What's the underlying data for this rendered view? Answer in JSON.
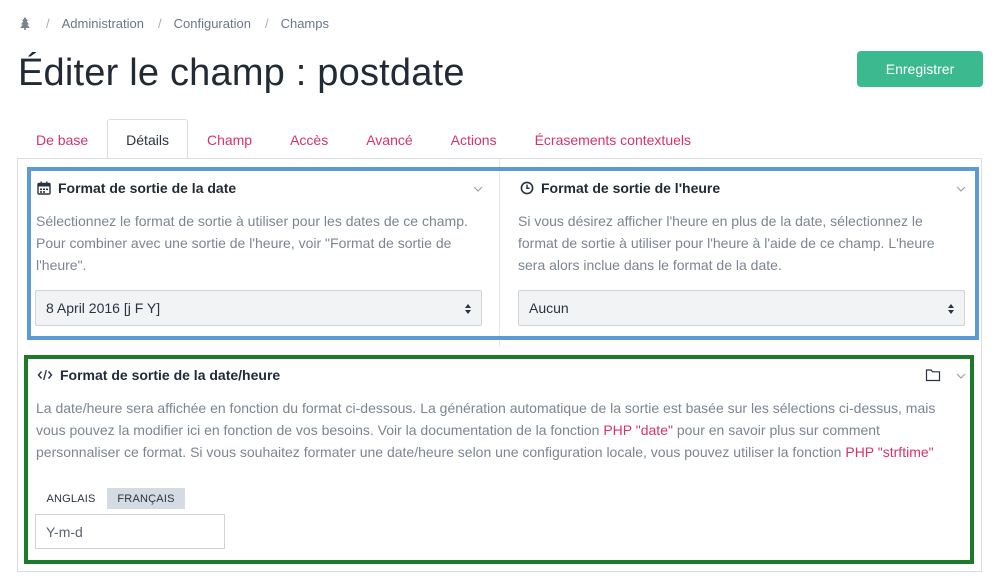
{
  "breadcrumb": {
    "home_icon": "tree-icon",
    "items": [
      "Administration",
      "Configuration",
      "Champs"
    ],
    "separator": "/"
  },
  "page": {
    "title": "Éditer le champ : postdate"
  },
  "toolbar": {
    "save_label": "Enregistrer",
    "save_color": "#3bb98f"
  },
  "tabs": [
    {
      "label": "De base",
      "active": false
    },
    {
      "label": "Détails",
      "active": true
    },
    {
      "label": "Champ",
      "active": false
    },
    {
      "label": "Accès",
      "active": false
    },
    {
      "label": "Avancé",
      "active": false
    },
    {
      "label": "Actions",
      "active": false
    },
    {
      "label": "Écrasements contextuels",
      "active": false
    }
  ],
  "date_format": {
    "icon": "calendar-icon",
    "title": "Format de sortie de la date",
    "help": "Sélectionnez le format de sortie à utiliser pour les dates de ce champ. Pour combiner avec une sortie de l'heure, voir \"Format de sortie de l'heure\".",
    "selected": "8 April 2016 [j F Y]"
  },
  "time_format": {
    "icon": "clock-icon",
    "title": "Format de sortie de l'heure",
    "help": "Si vous désirez afficher l'heure en plus de la date, sélectionnez le format de sortie à utiliser pour l'heure à l'aide de ce champ. L'heure sera alors inclue dans le format de la date.",
    "selected": "Aucun"
  },
  "datetime_format": {
    "icon": "code-icon",
    "title": "Format de sortie de la date/heure",
    "help_part1": "La date/heure sera affichée en fonction du format ci-dessous. La génération automatique de la sortie est basée sur les sélections ci-dessus, mais vous pouvez la modifier ici en fonction de vos besoins. Voir la documentation de la fonction ",
    "link1": "PHP \"date\"",
    "help_part2": " pour en savoir plus sur comment personnaliser ce format. Si vous souhaitez formater une date/heure selon une configuration locale, vous pouvez utiliser la fonction ",
    "link2": "PHP \"strftime\"",
    "lang_tabs": [
      {
        "label": "ANGLAIS",
        "active": false
      },
      {
        "label": "FRANÇAIS",
        "active": true
      }
    ],
    "value": "Y-m-d"
  },
  "colors": {
    "accent": "#d6336c",
    "highlight_top": "#5b9ad5",
    "highlight_bottom": "#1e7a2b"
  }
}
